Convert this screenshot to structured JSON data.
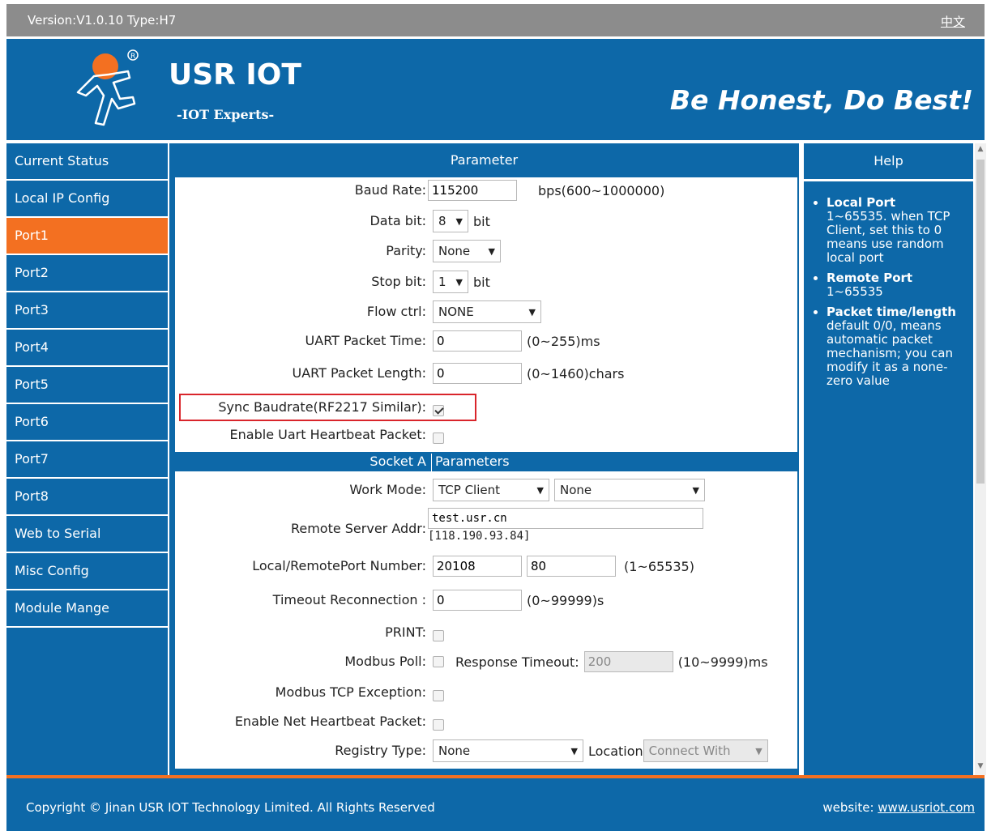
{
  "topbar": {
    "version": "Version:V1.0.10 Type:H7",
    "lang": "中文"
  },
  "header": {
    "brand": "USR IOT",
    "subtitle": "-IOT Experts-",
    "slogan": "Be Honest, Do Best!",
    "logo_icon": "running-man-logo-icon"
  },
  "colors": {
    "blue": "#0d68a8",
    "orange": "#f37021",
    "highlight": "#d9252b"
  },
  "sidebar": {
    "items": [
      {
        "label": "Current Status"
      },
      {
        "label": "Local IP Config"
      },
      {
        "label": "Port1",
        "active": true
      },
      {
        "label": "Port2"
      },
      {
        "label": "Port3"
      },
      {
        "label": "Port4"
      },
      {
        "label": "Port5"
      },
      {
        "label": "Port6"
      },
      {
        "label": "Port7"
      },
      {
        "label": "Port8"
      },
      {
        "label": "Web to Serial"
      },
      {
        "label": "Misc Config"
      },
      {
        "label": "Module Mange"
      }
    ]
  },
  "main": {
    "title": "Parameter",
    "baud": {
      "label": "Baud Rate:",
      "value": "115200",
      "unit": "bps(600~1000000)"
    },
    "databit": {
      "label": "Data bit:",
      "value": "8",
      "unit": "bit"
    },
    "parity": {
      "label": "Parity:",
      "value": "None"
    },
    "stopbit": {
      "label": "Stop bit:",
      "value": "1",
      "unit": "bit"
    },
    "flow": {
      "label": "Flow ctrl:",
      "value": "NONE"
    },
    "packet_time": {
      "label": "UART Packet Time:",
      "value": "0",
      "unit": "(0~255)ms"
    },
    "packet_len": {
      "label": "UART Packet Length:",
      "value": "0",
      "unit": "(0~1460)chars"
    },
    "sync": {
      "label": "Sync Baudrate(RF2217 Similar):",
      "checked": true
    },
    "uart_hb": {
      "label": "Enable Uart Heartbeat Packet:",
      "checked": false
    },
    "socket_a": {
      "left": "Socket A",
      "right": "Parameters"
    },
    "work_mode": {
      "label": "Work Mode:",
      "value": "TCP Client",
      "value2": "None"
    },
    "remote": {
      "label": "Remote Server Addr:",
      "value": "test.usr.cn",
      "resolved": "[118.190.93.84]"
    },
    "port": {
      "label": "Local/RemotePort Number:",
      "local": "20108",
      "remote": "80",
      "unit": "(1~65535)"
    },
    "timeout": {
      "label": "Timeout Reconnection :",
      "value": "0",
      "unit": "(0~99999)s"
    },
    "print": {
      "label": "PRINT:",
      "checked": false
    },
    "modbus_poll": {
      "label": "Modbus Poll:",
      "resp_label": "Response Timeout:",
      "resp_value": "200",
      "unit": "(10~9999)ms",
      "checked": false
    },
    "modbus_exc": {
      "label": "Modbus TCP Exception:",
      "checked": false
    },
    "net_hb": {
      "label": "Enable Net Heartbeat Packet:",
      "checked": false
    },
    "registry": {
      "label": "Registry Type:",
      "value": "None",
      "loc_label": "Location",
      "loc_value": "Connect With"
    }
  },
  "help": {
    "title": "Help",
    "items": [
      {
        "head": "Local Port",
        "text": "1~65535. when TCP Client, set this to 0 means use random local port"
      },
      {
        "head": "Remote Port",
        "text": "1~65535"
      },
      {
        "head": "Packet time/length",
        "text": "default 0/0, means automatic packet mechanism; you can modify it as a none-zero value"
      }
    ]
  },
  "footer": {
    "copyright": "Copyright © Jinan USR IOT Technology Limited. All Rights Reserved",
    "site_label": "website:",
    "site_link": "www.usriot.com"
  }
}
